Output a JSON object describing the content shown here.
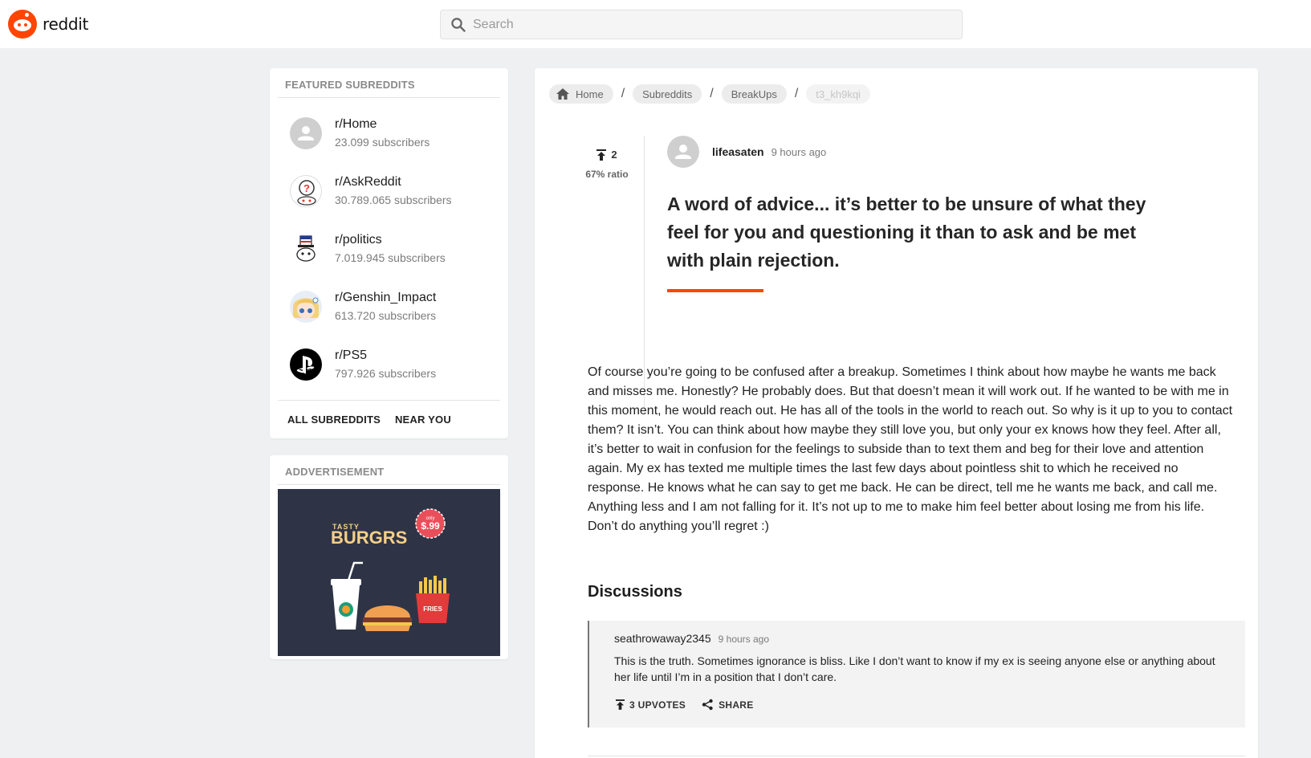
{
  "header": {
    "logo_text": "reddit",
    "search_placeholder": "Search",
    "accent": "#ff4500"
  },
  "sidebar": {
    "featured_title": "FEATURED SUBREDDITS",
    "subreddits": [
      {
        "name": "r/Home",
        "subscribers": "23.099 subscribers",
        "icon": "default-avatar-icon"
      },
      {
        "name": "r/AskReddit",
        "subscribers": "30.789.065 subscribers",
        "icon": "askreddit-avatar-icon"
      },
      {
        "name": "r/politics",
        "subscribers": "7.019.945 subscribers",
        "icon": "politics-avatar-icon"
      },
      {
        "name": "r/Genshin_Impact",
        "subscribers": "613.720 subscribers",
        "icon": "genshin-avatar-icon"
      },
      {
        "name": "r/PS5",
        "subscribers": "797.926 subscribers",
        "icon": "playstation-logo-icon"
      }
    ],
    "links": [
      "ALL SUBREDDITS",
      "NEAR YOU"
    ],
    "ad_title": "ADDVERTISEMENT",
    "ad": {
      "tag": "TASTY",
      "brand": "BURGRS",
      "badge_top": "only",
      "price": "$.99",
      "fries_label": "FRIES"
    }
  },
  "breadcrumb": [
    "Home",
    "Subreddits",
    "BreakUps",
    "t3_kh9kqi"
  ],
  "post": {
    "votes": "2",
    "ratio": "67% ratio",
    "author": "lifeasaten",
    "time": "9 hours ago",
    "title": "A word of advice... it’s better to be unsure of what they feel for you and questioning it than to ask and be met with plain rejection.",
    "body": "Of course you’re going to be confused after a breakup. Sometimes I think about how maybe he wants me back and misses me. Honestly? He probably does. But that doesn’t mean it will work out. If he wanted to be with me in this moment, he would reach out. He has all of the tools in the world to reach out. So why is it up to you to contact them? It isn’t. You can think about how maybe they still love you, but only your ex knows how they feel. After all, it’s better to wait in confusion for the feelings to subside than to text them and beg for their love and attention again. My ex has texted me multiple times the last few days about pointless shit to which he received no response. He knows what he can say to get me back. He can be direct, tell me he wants me back, and call me. Anything less and I am not falling for it. It’s not up to me to make him feel better about losing me from his life. Don’t do anything you’ll regret :)"
  },
  "discussions": {
    "title": "Discussions",
    "comments": [
      {
        "author": "seathrowaway2345",
        "time": "9 hours ago",
        "text": "This is the truth. Sometimes ignorance is bliss. Like I don’t want to know if my ex is seeing anyone else or anything about her life until I’m in a position that I don’t care.",
        "upvotes_label": "3 UPVOTES",
        "share_label": "SHARE"
      }
    ]
  }
}
